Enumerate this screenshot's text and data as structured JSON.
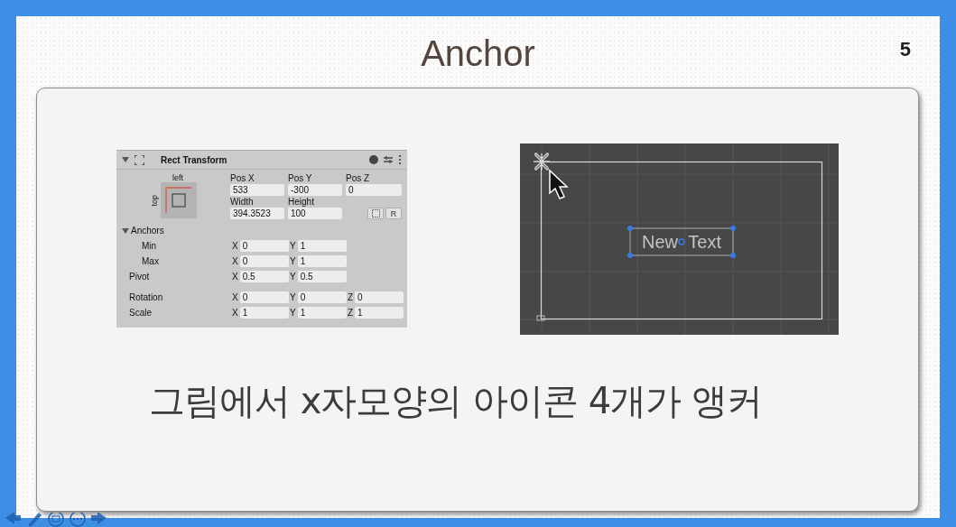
{
  "slide": {
    "title": "Anchor",
    "page_number": "5",
    "caption": "그림에서 x자모양의 아이콘 4개가 앵커"
  },
  "inspector": {
    "title": "Rect Transform",
    "expanded": true,
    "preset_horizontal": "left",
    "preset_vertical": "top",
    "position_labels": [
      "Pos X",
      "Pos Y",
      "Pos Z"
    ],
    "position_values": [
      "533",
      "-300",
      "0"
    ],
    "size_labels": [
      "Width",
      "Height"
    ],
    "size_values": [
      "394.3523",
      "100"
    ],
    "raw_button": "R",
    "anchors": {
      "label": "Anchors",
      "expanded": true,
      "rows": [
        {
          "label": "Min",
          "fields": [
            {
              "axis": "X",
              "value": "0"
            },
            {
              "axis": "Y",
              "value": "1"
            }
          ]
        },
        {
          "label": "Max",
          "fields": [
            {
              "axis": "X",
              "value": "0"
            },
            {
              "axis": "Y",
              "value": "1"
            }
          ]
        }
      ]
    },
    "rows": [
      {
        "label": "Pivot",
        "fields": [
          {
            "axis": "X",
            "value": "0.5"
          },
          {
            "axis": "Y",
            "value": "0.5"
          }
        ]
      },
      {
        "label": "Rotation",
        "fields": [
          {
            "axis": "X",
            "value": "0"
          },
          {
            "axis": "Y",
            "value": "0"
          },
          {
            "axis": "Z",
            "value": "0"
          }
        ]
      },
      {
        "label": "Scale",
        "fields": [
          {
            "axis": "X",
            "value": "1"
          },
          {
            "axis": "Y",
            "value": "1"
          },
          {
            "axis": "Z",
            "value": "1"
          }
        ]
      }
    ]
  },
  "scene": {
    "object_text": "New Text"
  }
}
